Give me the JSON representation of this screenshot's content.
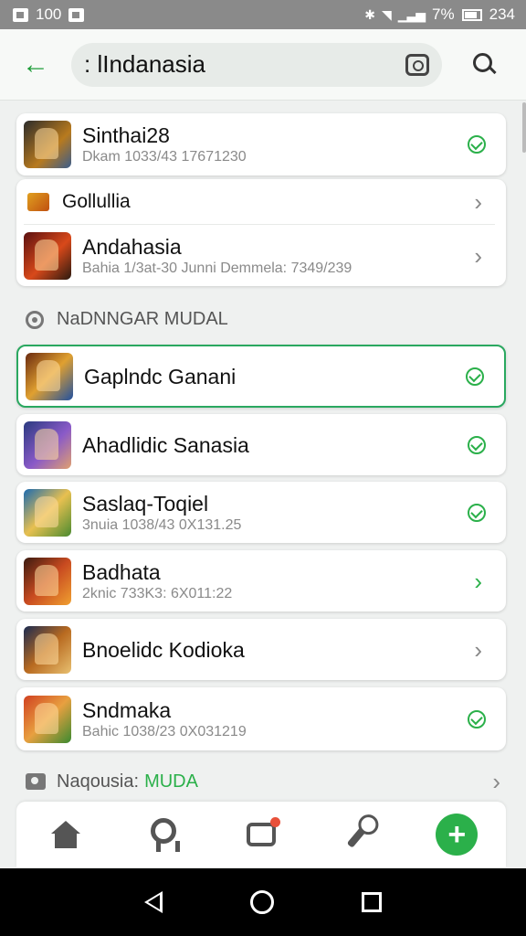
{
  "status_bar": {
    "left_text": "100",
    "right_text": "7%",
    "time": "234"
  },
  "app_bar": {
    "search_value": ": lIndanasia"
  },
  "groups": [
    {
      "items": [
        {
          "title": "Sinthai28",
          "subtitle": "Dkam 1033/43 17671230",
          "action": "check"
        }
      ]
    },
    {
      "items": [
        {
          "title": "Gollullia",
          "subtitle": "",
          "action": "chevron"
        },
        {
          "title": "Andahasia",
          "subtitle": "Bahia 1/3at-30 Junni Demmela: 7349/239",
          "action": "chevron"
        }
      ]
    }
  ],
  "section_1": {
    "title": "NaDNNGAR MUDAL"
  },
  "list": [
    {
      "title": "Gaplndc Ganani",
      "subtitle": "",
      "action": "check",
      "highlighted": true
    },
    {
      "title": "Ahadlidic Sanasia",
      "subtitle": "",
      "action": "check"
    },
    {
      "title": "Saslaq-Toqiel",
      "subtitle": "3nuia 1038/43 0X131.25",
      "action": "check"
    },
    {
      "title": "Badhata",
      "subtitle": "2knic 733K3: 6X011:22",
      "action": "chevron-green"
    },
    {
      "title": "Bnoelidc Kodioka",
      "subtitle": "",
      "action": "chevron"
    },
    {
      "title": "Sndmaka",
      "subtitle": "Bahic 1038/23 0X031219",
      "action": "check"
    }
  ],
  "section_2": {
    "title": "Naqousia:",
    "accent": "MUDA"
  },
  "bottom_nav": [
    "home",
    "badge",
    "route",
    "brush",
    "add"
  ],
  "colors": {
    "accent": "#2bb04a",
    "highlight_border": "#2aa860"
  }
}
